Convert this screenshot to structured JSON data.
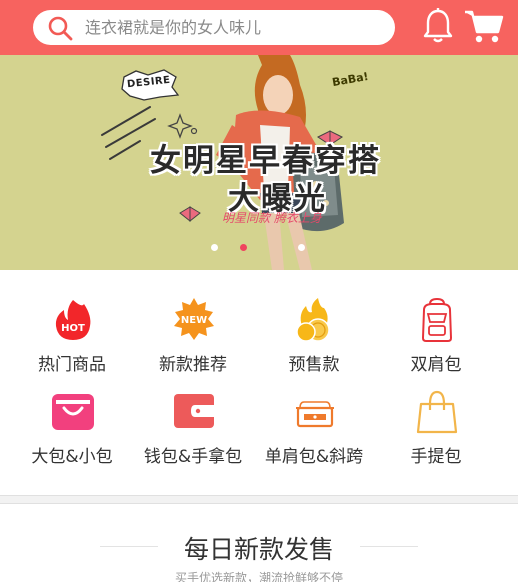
{
  "header": {
    "search_placeholder": "连衣裙就是你的女人味儿",
    "icons": {
      "search": "search-icon",
      "bell": "bell-icon",
      "cart": "cart-icon"
    },
    "color": "#f7635f"
  },
  "banner": {
    "title_line1": "女明星早春穿搭",
    "title_line2": "大曝光",
    "subtitle": "明星同款 腾衣上身",
    "sticker_left": "DESIRE",
    "sticker_right": "BaBa!",
    "background": "#d4d38f",
    "slides": 3,
    "active_slide": 2
  },
  "categories": [
    {
      "label": "热门商品",
      "icon": "hot-icon"
    },
    {
      "label": "新款推荐",
      "icon": "new-badge-icon"
    },
    {
      "label": "预售款",
      "icon": "coins-icon"
    },
    {
      "label": "双肩包",
      "icon": "backpack-icon"
    },
    {
      "label": "大包&小包",
      "icon": "shopping-bag-icon"
    },
    {
      "label": "钱包&手拿包",
      "icon": "wallet-icon"
    },
    {
      "label": "单肩包&斜跨",
      "icon": "shoulder-bag-icon"
    },
    {
      "label": "手提包",
      "icon": "handbag-icon"
    }
  ],
  "section": {
    "title": "每日新款发售",
    "subtitle": "买手优选新款，潮流抢鲜够不停"
  }
}
